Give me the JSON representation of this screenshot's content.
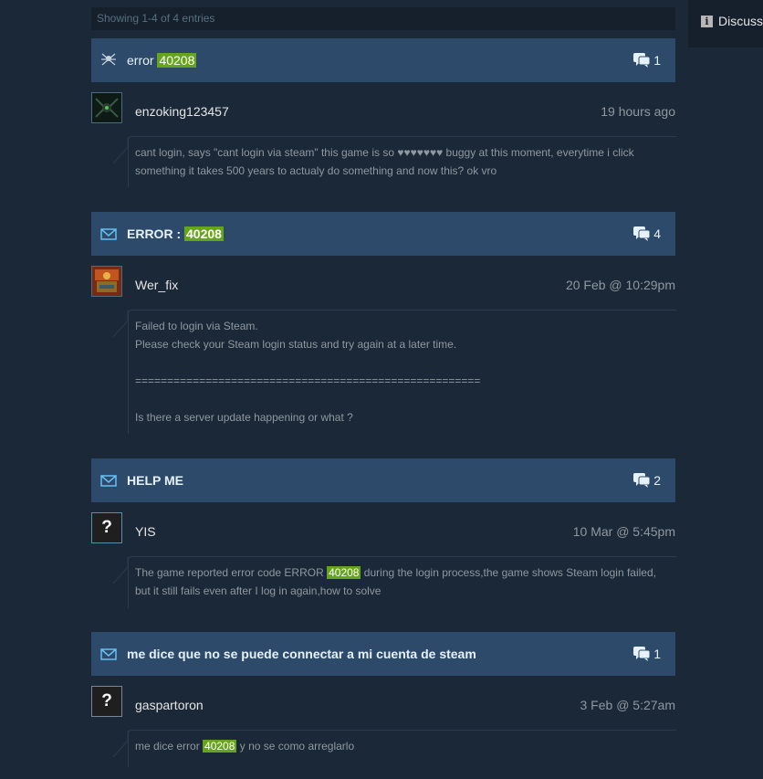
{
  "list": {
    "showing_text": "Showing 1-4 of 4 entries"
  },
  "sidebar": {
    "discuss_label": "Discuss"
  },
  "colors": {
    "background": "#1b2838",
    "thread_header": "#2e4a6b",
    "highlight": "#66a51b"
  },
  "threads": [
    {
      "icon": "spider-avatar-icon",
      "title_pre": "error ",
      "title_hl": "40208",
      "title_post": "",
      "replies": "1",
      "author": "enzoking123457",
      "date": "19 hours ago",
      "body_pre": "cant login, says \"cant login via steam\" this game is so ♥♥♥♥♥♥♥ buggy at this moment, everytime i click something it takes 500 years to actualy do something and now this? ok vro",
      "body_hl": "",
      "body_post": ""
    },
    {
      "icon": "envelope-icon",
      "title_pre": "ERROR : ",
      "title_hl": "40208",
      "title_post": "",
      "replies": "4",
      "author": "Wer_fix",
      "date": "20 Feb @ 10:29pm",
      "body_pre": "Failed to login via Steam.\nPlease check your Steam login status and try again at a later time.\n\n======================================================\n\nIs there a server update happening or what ?",
      "body_hl": "",
      "body_post": ""
    },
    {
      "icon": "envelope-icon",
      "title_pre": "HELP ME",
      "title_hl": "",
      "title_post": "",
      "replies": "2",
      "author": "YIS",
      "date": "10 Mar @ 5:45pm",
      "body_pre": "The game reported error code ERROR ",
      "body_hl": "40208",
      "body_post": " during the login process,the game shows Steam login failed, but it still fails even after I log in again,how to solve"
    },
    {
      "icon": "envelope-icon",
      "title_pre": "me dice que no se puede connectar a mi cuenta de steam",
      "title_hl": "",
      "title_post": "",
      "replies": "1",
      "author": "gaspartoron",
      "date": "3 Feb @ 5:27am",
      "body_pre": "me dice error ",
      "body_hl": "40208",
      "body_post": " y no se como arreglarlo"
    }
  ],
  "avatar_glyph": "?"
}
